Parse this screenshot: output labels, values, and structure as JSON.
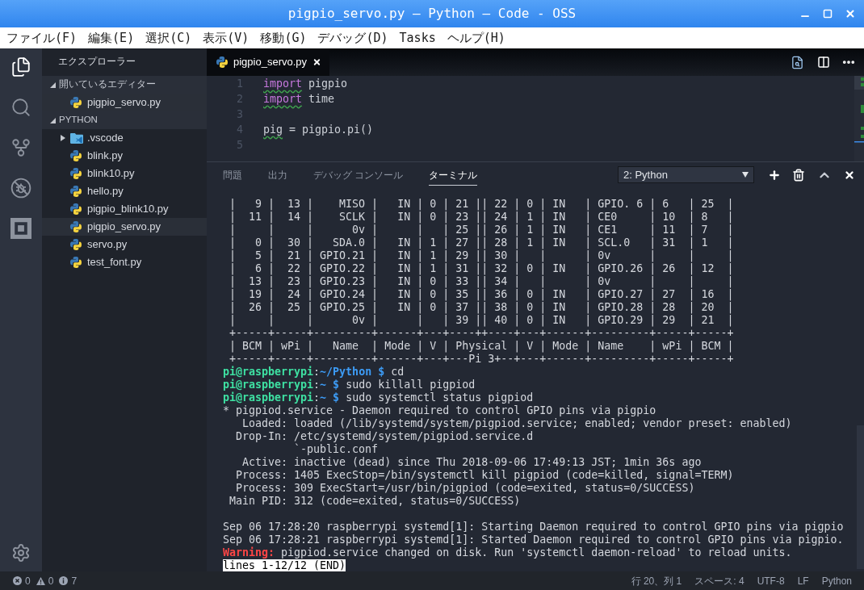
{
  "window": {
    "title": "pigpio_servo.py — Python — Code - OSS"
  },
  "menu_bar": [
    "ファイル(F)",
    "編集(E)",
    "選択(C)",
    "表示(V)",
    "移動(G)",
    "デバッグ(D)",
    "Tasks",
    "ヘルプ(H)"
  ],
  "activity_bar": [
    {
      "selected": true
    },
    {
      "selected": false
    },
    {
      "selected": false
    },
    {
      "selected": false
    },
    {
      "selected": false
    }
  ],
  "sidebar": {
    "title": "エクスプローラー",
    "sections": [
      {
        "title": "開いているエディター",
        "expanded": true,
        "items": [
          {
            "name": "pigpio_servo.py",
            "kind": "python",
            "selected": true
          }
        ]
      },
      {
        "title": "PYTHON",
        "expanded": true,
        "items": [
          {
            "name": ".vscode",
            "kind": "folder",
            "expanded": false,
            "selected": false
          },
          {
            "name": "blink.py",
            "kind": "python",
            "selected": false
          },
          {
            "name": "blink10.py",
            "kind": "python",
            "selected": false
          },
          {
            "name": "hello.py",
            "kind": "python",
            "selected": false
          },
          {
            "name": "pigpio_blink10.py",
            "kind": "python",
            "selected": false
          },
          {
            "name": "pigpio_servo.py",
            "kind": "python",
            "selected": true
          },
          {
            "name": "servo.py",
            "kind": "python",
            "selected": false
          },
          {
            "name": "test_font.py",
            "kind": "python",
            "selected": false
          }
        ]
      }
    ]
  },
  "editor": {
    "tabs": [
      {
        "label": "pigpio_servo.py",
        "selected": true
      }
    ],
    "lines": [
      {
        "number": "1",
        "tokens": [
          {
            "text": "import",
            "kind": "keyword",
            "squiggle": true
          },
          {
            "text": " pigpio",
            "kind": "plain",
            "squiggle": false
          }
        ]
      },
      {
        "number": "2",
        "tokens": [
          {
            "text": "import",
            "kind": "keyword",
            "squiggle": true
          },
          {
            "text": " time",
            "kind": "plain",
            "squiggle": false
          }
        ]
      },
      {
        "number": "3"
      },
      {
        "number": "4",
        "tokens": [
          {
            "text": "pig",
            "kind": "plain",
            "squiggle": true
          },
          {
            "text": " = ",
            "kind": "operator",
            "squiggle": false
          },
          {
            "text": "pigpio.pi()",
            "kind": "plain",
            "squiggle": false
          }
        ]
      },
      {
        "number": "5"
      }
    ]
  },
  "panel": {
    "tabs": [
      {
        "label": "問題",
        "selected": false
      },
      {
        "label": "出力",
        "selected": false
      },
      {
        "label": "デバッグ コンソール",
        "selected": false
      },
      {
        "label": "ターミナル",
        "selected": true
      }
    ],
    "terminal_select": {
      "value": "2: Python"
    },
    "terminal": [
      {
        "kind": "output",
        "text": " |   9 |  13 |    MISO |   IN | 0 | 21 || 22 | 0 | IN   | GPIO. 6 | 6   | 25  |"
      },
      {
        "kind": "output",
        "text": " |  11 |  14 |    SCLK |   IN | 0 | 23 || 24 | 1 | IN   | CE0     | 10  | 8   |"
      },
      {
        "kind": "output",
        "text": " |     |     |      0v |      |   | 25 || 26 | 1 | IN   | CE1     | 11  | 7   |"
      },
      {
        "kind": "output",
        "text": " |   0 |  30 |   SDA.0 |   IN | 1 | 27 || 28 | 1 | IN   | SCL.0   | 31  | 1   |"
      },
      {
        "kind": "output",
        "text": " |   5 |  21 | GPIO.21 |   IN | 1 | 29 || 30 |   |      | 0v      |     |     |"
      },
      {
        "kind": "output",
        "text": " |   6 |  22 | GPIO.22 |   IN | 1 | 31 || 32 | 0 | IN   | GPIO.26 | 26  | 12  |"
      },
      {
        "kind": "output",
        "text": " |  13 |  23 | GPIO.23 |   IN | 0 | 33 || 34 |   |      | 0v      |     |     |"
      },
      {
        "kind": "output",
        "text": " |  19 |  24 | GPIO.24 |   IN | 0 | 35 || 36 | 0 | IN   | GPIO.27 | 27  | 16  |"
      },
      {
        "kind": "output",
        "text": " |  26 |  25 | GPIO.25 |   IN | 0 | 37 || 38 | 0 | IN   | GPIO.28 | 28  | 20  |"
      },
      {
        "kind": "output",
        "text": " |     |     |      0v |      |   | 39 || 40 | 0 | IN   | GPIO.29 | 29  | 21  |"
      },
      {
        "kind": "output",
        "text": " +-----+-----+---------+------+---+----++----+---+------+---------+-----+-----+"
      },
      {
        "kind": "output",
        "text": " | BCM | wPi |   Name  | Mode | V | Physical | V | Mode | Name    | wPi | BCM |"
      },
      {
        "kind": "output",
        "text": " +-----+-----+---------+------+---+---Pi 3+--+---+------+---------+-----+-----+"
      },
      {
        "kind": "prompt",
        "user": "pi@raspberrypi",
        "separator": ":",
        "cwd": "~/Python $",
        "command": "cd"
      },
      {
        "kind": "prompt",
        "user": "pi@raspberrypi",
        "separator": ":",
        "cwd": "~ $",
        "command": "sudo killall pigpiod"
      },
      {
        "kind": "prompt",
        "user": "pi@raspberrypi",
        "separator": ":",
        "cwd": "~ $",
        "command": "sudo systemctl status pigpiod"
      },
      {
        "kind": "output",
        "text": "* pigpiod.service - Daemon required to control GPIO pins via pigpio"
      },
      {
        "kind": "output",
        "text": "   Loaded: loaded (/lib/systemd/system/pigpiod.service; enabled; vendor preset: enabled)"
      },
      {
        "kind": "output",
        "text": "  Drop-In: /etc/systemd/system/pigpiod.service.d"
      },
      {
        "kind": "output",
        "text": "           `-public.conf"
      },
      {
        "kind": "output",
        "text": "   Active: inactive (dead) since Thu 2018-09-06 17:49:13 JST; 1min 36s ago"
      },
      {
        "kind": "output",
        "text": "  Process: 1405 ExecStop=/bin/systemctl kill pigpiod (code=killed, signal=TERM)"
      },
      {
        "kind": "output",
        "text": "  Process: 309 ExecStart=/usr/bin/pigpiod (code=exited, status=0/SUCCESS)"
      },
      {
        "kind": "output",
        "text": " Main PID: 312 (code=exited, status=0/SUCCESS)"
      },
      {
        "kind": "blank"
      },
      {
        "kind": "output",
        "text": "Sep 06 17:28:20 raspberrypi systemd[1]: Starting Daemon required to control GPIO pins via pigpio"
      },
      {
        "kind": "output",
        "text": "Sep 06 17:28:21 raspberrypi systemd[1]: Started Daemon required to control GPIO pins via pigpio."
      },
      {
        "kind": "warning",
        "label": "Warning:",
        "text": "pigpiod.service changed on disk. Run 'systemctl daemon-reload' to reload units."
      },
      {
        "kind": "pager",
        "text": "lines 1-12/12 (END)"
      }
    ]
  },
  "status_bar": {
    "problems": [
      {
        "kind": "error",
        "count": "0"
      },
      {
        "kind": "warning",
        "count": "0"
      },
      {
        "kind": "info",
        "count": "7"
      }
    ],
    "items": [
      "行 20、列 1",
      "スペース: 4",
      "UTF-8",
      "LF",
      "Python"
    ]
  }
}
